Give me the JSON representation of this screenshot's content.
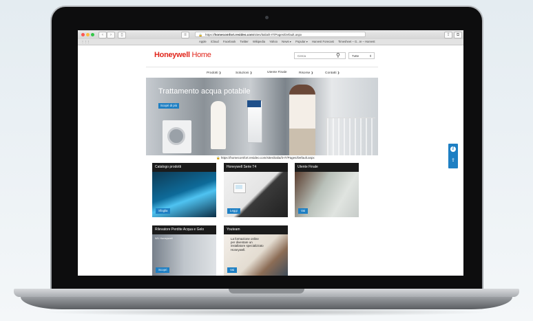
{
  "browser": {
    "url_prefix": "https://",
    "url_host": "homecomfort.resideo.com",
    "url_path": "/sites/italia/it-IT/Pages/Default.aspx",
    "bookmarks": [
      "Apple",
      "iCloud",
      "Facebook",
      "Twitter",
      "Wikipedia",
      "Yahoo",
      "News ▾",
      "Popular ▾",
      "Harvest Forecast",
      "Timesheet – G...re – Harvest"
    ]
  },
  "header": {
    "logo_brand": "Honeywell",
    "logo_suffix": " Home",
    "search_placeholder": "Cerca",
    "scope_selected": "Tutte"
  },
  "menu": {
    "items": [
      "Prodotti",
      "Soluzioni",
      "Utente Finale",
      "Risorse",
      "Contatti"
    ]
  },
  "hero": {
    "title": "Trattamento acqua potabile",
    "button": "Scopri di più"
  },
  "status_url": "https://homecomfort.resideo.com/sites/italia/it-IT/Pages/Default.aspx",
  "cards": [
    {
      "title": "Catalogo prodotti",
      "button": "Sfoglia"
    },
    {
      "title": "Honeywell Serie T4",
      "button": "Leggi"
    },
    {
      "title": "Utente Finale",
      "button": "Vai"
    },
    {
      "title": "Rilevatore Perdite Acqua e Gelo",
      "subtitle": "W1 Honeywell",
      "button": "Scopri"
    },
    {
      "title": "Youteam",
      "text": "La formazione online per diventare un installatore specializzato Honeywell.",
      "button": "Vai"
    }
  ],
  "colors": {
    "brand_red": "#e1261c",
    "accent_blue": "#1e7fc3"
  }
}
